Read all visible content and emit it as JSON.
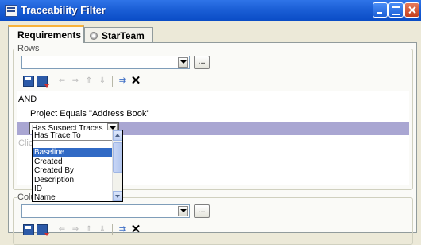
{
  "window": {
    "title": "Traceability Filter"
  },
  "tabs": [
    {
      "label": "Requirements",
      "icon": "diamond-icon"
    },
    {
      "label": "StarTeam",
      "icon": "starteam-icon"
    }
  ],
  "rows_group": {
    "legend": "Rows",
    "combo_value": "",
    "ellipsis_label": "...",
    "tree": {
      "root": "AND",
      "condition": "Project Equals \"Address Book\"",
      "selected_combo_value": "Has Suspect Traces",
      "hint_prefix": "Clic"
    }
  },
  "dropdown": {
    "top_item": "Has Trace To",
    "items": [
      "Baseline",
      "Created",
      "Created By",
      "Description",
      "ID",
      "Name"
    ],
    "highlighted": "Baseline"
  },
  "columns_group": {
    "legend": "Colu",
    "combo_value": "",
    "ellipsis_label": "..."
  },
  "toolbar_icons": [
    "save-icon",
    "save-down-icon",
    "move-left-icon",
    "move-right-icon",
    "move-up-icon",
    "move-down-icon",
    "insert-row-icon",
    "delete-icon"
  ],
  "colors": {
    "titlebar": "#0a4cc6",
    "selection": "#a9a6d2",
    "list_highlight": "#316ac5"
  }
}
